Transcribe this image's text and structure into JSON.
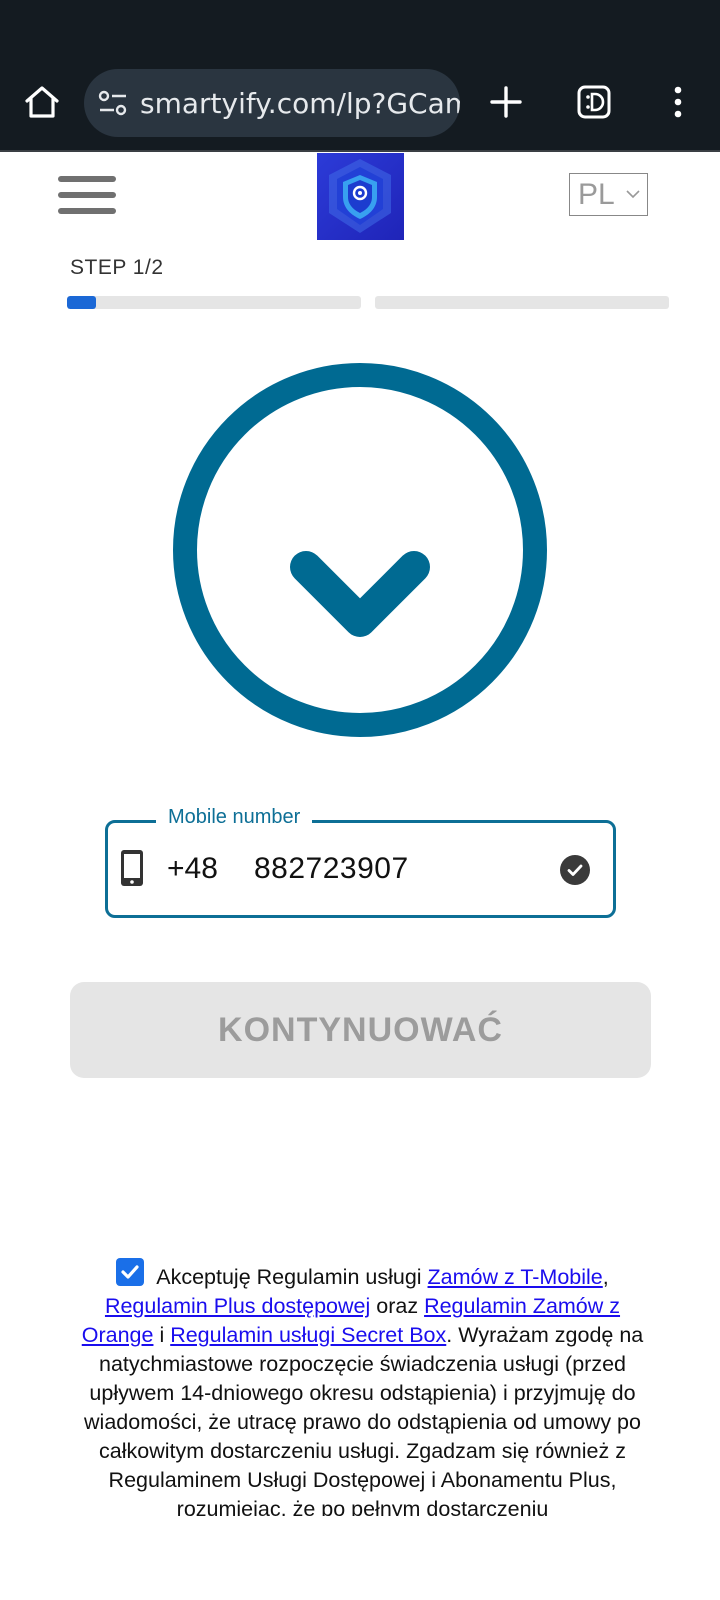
{
  "browser": {
    "url": "smartyify.com/lp?GCamp"
  },
  "header": {
    "language": "PL"
  },
  "step": {
    "label": "STEP 1/2",
    "progress": [
      0.1,
      0
    ]
  },
  "phone_field": {
    "label": "Mobile number",
    "country_code": "+48",
    "number": "882723907"
  },
  "cta": {
    "label": "KONTYNUOWAĆ"
  },
  "consent": {
    "checked": true,
    "t1": "Akceptuję Regulamin usługi ",
    "link1": "Zamów z T-Mobile",
    "t2": ", ",
    "link2": "Regulamin Plus dostępowej",
    "t3": " oraz ",
    "link3": "Regulamin Zamów z Orange",
    "t4": " i ",
    "link4": "Regulamin usługi Secret Box",
    "t5": ". Wyrażam zgodę na natychmiastowe rozpoczęcie świadczenia usługi (przed upływem 14-dniowego okresu odstąpienia) i przyjmuję do wiadomości, że utracę prawo do odstąpienia od umowy po całkowitym dostarczeniu usługi. Zgadzam się również z Regulaminem Usługi Dostępowej i Abonamentu Plus, rozumiejąc, że po pełnym dostarczeniu"
  },
  "colors": {
    "accent": "#0d6f96",
    "progress": "#1b68d6",
    "link": "#1a0dee",
    "checkbox": "#1a6fe8"
  }
}
